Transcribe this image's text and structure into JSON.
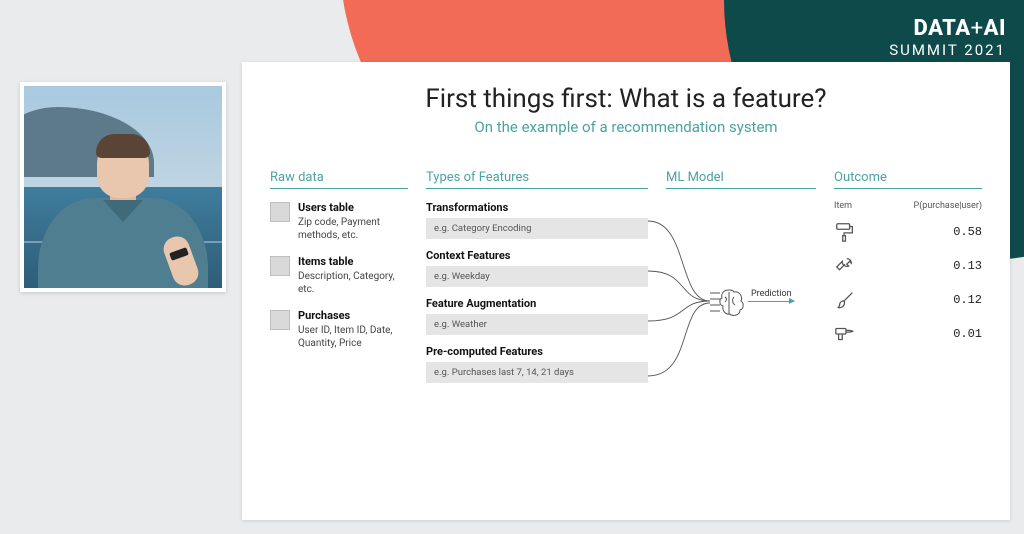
{
  "event": {
    "logo_top": "DATA+AI",
    "logo_bottom": "SUMMIT 2021"
  },
  "slide": {
    "title": "First things first: What is a feature?",
    "subtitle": "On the example of a recommendation system",
    "columns": {
      "raw": {
        "heading": "Raw data",
        "items": [
          {
            "title": "Users table",
            "desc": "Zip code, Payment methods, etc."
          },
          {
            "title": "Items table",
            "desc": "Description, Category, etc."
          },
          {
            "title": "Purchases",
            "desc": "User ID, Item ID, Date, Quantity, Price"
          }
        ]
      },
      "features": {
        "heading": "Types of Features",
        "groups": [
          {
            "label": "Transformations",
            "example": "e.g. Category Encoding"
          },
          {
            "label": "Context Features",
            "example": "e.g. Weekday"
          },
          {
            "label": "Feature Augmentation",
            "example": "e.g. Weather"
          },
          {
            "label": "Pre-computed Features",
            "example": "e.g. Purchases last 7, 14, 21 days"
          }
        ]
      },
      "model": {
        "heading": "ML Model",
        "prediction_label": "Prediction"
      },
      "outcome": {
        "heading": "Outcome",
        "header_item": "Item",
        "header_prob": "P(purchase|user)",
        "rows": [
          {
            "icon": "paint-roller",
            "value": "0.58"
          },
          {
            "icon": "wrench",
            "value": "0.13"
          },
          {
            "icon": "paint-brush",
            "value": "0.12"
          },
          {
            "icon": "drill",
            "value": "0.01"
          }
        ]
      }
    }
  }
}
